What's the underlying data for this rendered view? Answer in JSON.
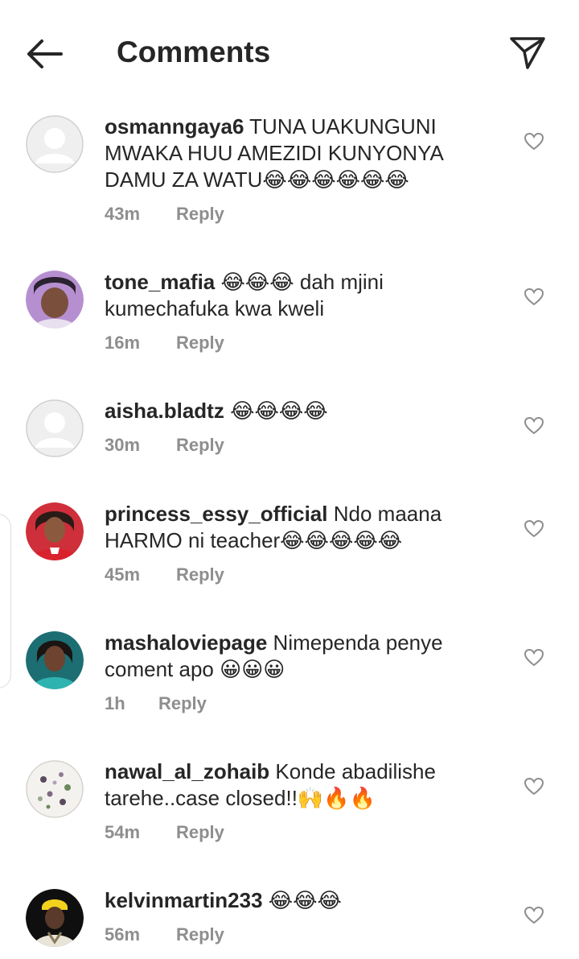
{
  "header": {
    "title": "Comments"
  },
  "reply_label": "Reply",
  "comments": [
    {
      "username": "osmanngaya6",
      "text": "TUNA UAKUNGUNI MWAKA HUU AMEZIDI KUNYONYA DAMU ZA WATU😂😂😂😂😂😂",
      "time": "43m"
    },
    {
      "username": "tone_mafia",
      "text": "😂😂😂 dah mjini kumechafuka kwa kweli",
      "time": "16m"
    },
    {
      "username": "aisha.bladtz",
      "text": "😂😂😂😂",
      "time": "30m"
    },
    {
      "username": "princess_essy_official",
      "text": "Ndo maana HARMO ni teacher😂😂😂😂😂",
      "time": "45m"
    },
    {
      "username": "mashaloviepage",
      "text": "Nimependa penye coment apo 😀😀😀",
      "time": "1h"
    },
    {
      "username": "nawal_al_zohaib",
      "text": "Konde abadilishe tarehe..case closed!!🙌🔥🔥",
      "time": "54m"
    },
    {
      "username": "kelvinmartin233",
      "text": "😂😂😂",
      "time": "56m"
    }
  ]
}
